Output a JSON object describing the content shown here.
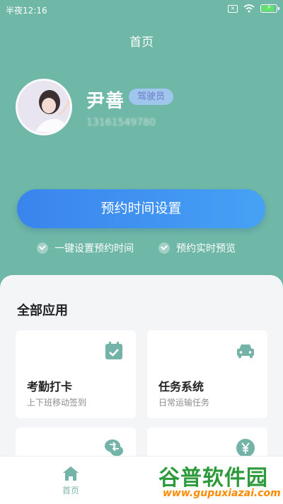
{
  "status_bar": {
    "time": "半夜12:16",
    "sim_label": "×"
  },
  "header": {
    "title": "首页"
  },
  "profile": {
    "name": "尹善",
    "role": "驾驶员",
    "phone": "13161549780"
  },
  "actions": {
    "main_button": "预约时间设置",
    "features": [
      "一键设置预约时间",
      "预约实时预览"
    ]
  },
  "apps": {
    "section_title": "全部应用",
    "cards": [
      {
        "title": "考勤打卡",
        "subtitle": "上下班移动签到",
        "icon": "calendar-check-icon"
      },
      {
        "title": "任务系统",
        "subtitle": "日常运输任务",
        "icon": "car-icon"
      },
      {
        "title": "",
        "subtitle": "",
        "icon": "chat-transfer-icon"
      },
      {
        "title": "",
        "subtitle": "",
        "icon": "yen-icon"
      }
    ]
  },
  "bottom_nav": {
    "home_label": "首页",
    "home_icon": "home-icon"
  },
  "watermark": {
    "title": "谷普软件园",
    "url": "www.gupuxiazai.com"
  },
  "colors": {
    "background": "#6fb7a6",
    "accent": "#3a84ee",
    "icon_green": "#74b3a7",
    "badge": "#9fc6ec"
  }
}
